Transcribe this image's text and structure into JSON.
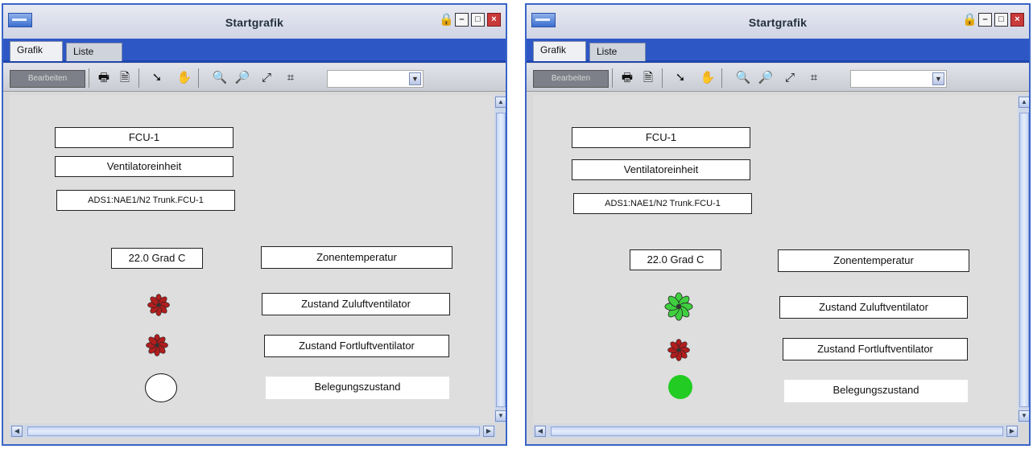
{
  "windows": [
    {
      "title": "Startgrafik",
      "tabs": [
        "Grafik",
        "Liste"
      ],
      "toolbar": {
        "mode_label": "Bearbeiten"
      },
      "canvas": {
        "device_name": "FCU-1",
        "device_type": "Ventilatoreinheit",
        "device_path": "ADS1:NAE1/N2 Trunk.FCU-1",
        "temperature_value": "22.0 Grad C",
        "zone_temp_label": "Zonentemperatur",
        "supply_fan_label": "Zustand Zuluftventilator",
        "exhaust_fan_label": "Zustand Fortluftventilator",
        "occupancy_label": "Belegungszustand"
      },
      "status": {
        "supply_fan": "off",
        "exhaust_fan": "off",
        "occupancy": "unoccupied"
      }
    },
    {
      "title": "Startgrafik",
      "tabs": [
        "Grafik",
        "Liste"
      ],
      "toolbar": {
        "mode_label": "Bearbeiten"
      },
      "canvas": {
        "device_name": "FCU-1",
        "device_type": "Ventilatoreinheit",
        "device_path": "ADS1:NAE1/N2 Trunk.FCU-1",
        "temperature_value": "22.0 Grad C",
        "zone_temp_label": "Zonentemperatur",
        "supply_fan_label": "Zustand Zuluftventilator",
        "exhaust_fan_label": "Zustand Fortluftventilator",
        "occupancy_label": "Belegungszustand"
      },
      "status": {
        "supply_fan": "on",
        "exhaust_fan": "off",
        "occupancy": "occupied"
      }
    }
  ],
  "colors": {
    "fan_off": "#b01e1e",
    "fan_on": "#3fcf3f",
    "occupied": "#22cc22",
    "tab_bar": "#2d57c5"
  },
  "icons": [
    "window-menu-icon",
    "lock-icon",
    "minimize-icon",
    "maximize-icon",
    "close-icon",
    "print-icon",
    "print-preview-icon",
    "pointer-icon",
    "pan-hand-icon",
    "zoom-out-icon",
    "zoom-in-icon",
    "zoom-fit-icon",
    "zoom-reset-icon"
  ]
}
